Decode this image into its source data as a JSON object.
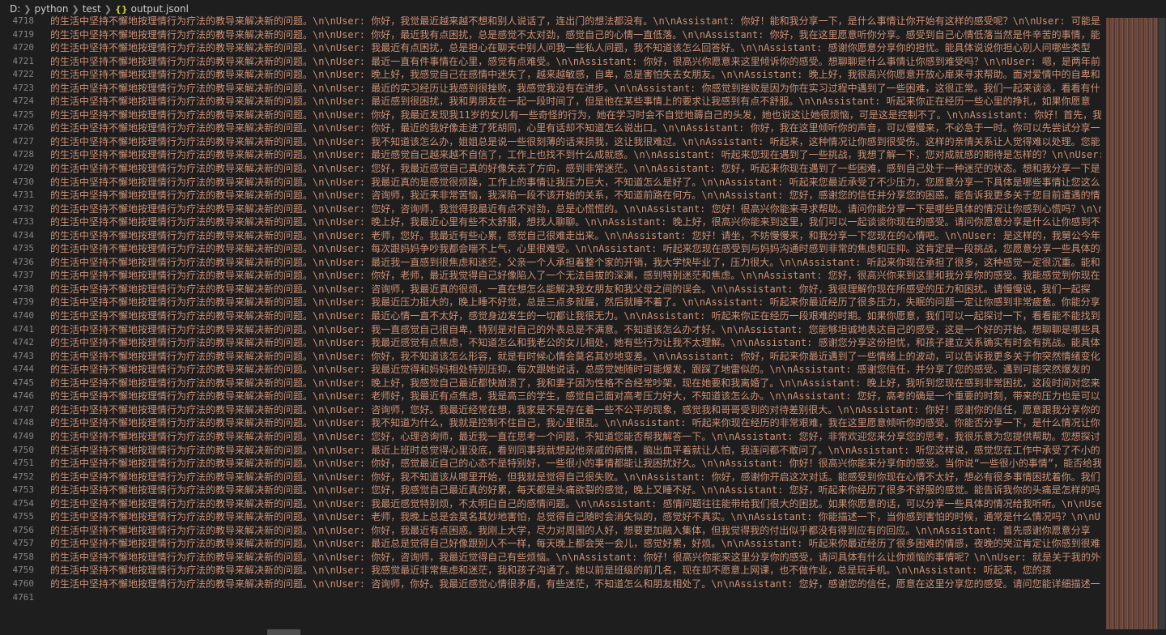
{
  "breadcrumb": {
    "drive": "D:",
    "folder1": "python",
    "folder2": "test",
    "icon": "{}",
    "file": "output.jsonl"
  },
  "editor": {
    "lines": [
      {
        "num": "4718",
        "text": "的生活中坚持不懈地按理情行为疗法的教导来解决新的问题。\\n\\nUser: 你好，我觉最近越来越不想和别人说话了，连出门的想法都没有。\\n\\nAssistant: 你好！能和我分享一下，是什么事情让你开始有这样的感受呢？\\n\\nUser: 可能是从"
      },
      {
        "num": "4719",
        "text": "的生活中坚持不懈地按理情行为疗法的教导来解决新的问题。\\n\\nUser: 你好，最近我有点困扰，总是感觉不太对劲，感觉自己的心情一直低落。\\n\\nAssistant: 你好，我在这里愿意听你分享。感受到自己心情低落当然是件辛苦的事情，能"
      },
      {
        "num": "4720",
        "text": "的生活中坚持不懈地按理情行为疗法的教导来解决新的问题。\\n\\nUser: 我最近有点困扰，总是担心在聊天中别人问我一些私人问题，我不知道该怎么回答好。\\n\\nAssistant: 感谢你愿意分享你的担忧。能具体说说你担心别人问哪些类型"
      },
      {
        "num": "4721",
        "text": "的生活中坚持不懈地按理情行为疗法的教导来解决新的问题。\\n\\nUser: 最近一直有件事情在心里，感觉有点难受。\\n\\nAssistant: 你好，很高兴你愿意来这里倾诉你的感受。想聊聊是什么事情让你感到难受吗？\\n\\nUser: 嗯，是两年前的"
      },
      {
        "num": "4722",
        "text": "的生活中坚持不懈地按理情行为疗法的教导来解决新的问题。\\n\\nUser: 晚上好，我感觉自己在感情中迷失了，越来越敏感，自卑，总是害怕失去女朋友。\\n\\nAssistant: 晚上好，我很高兴你愿意开放心扉来寻求帮助。面对爱情中的自卑和"
      },
      {
        "num": "4723",
        "text": "的生活中坚持不懈地按理情行为疗法的教导来解决新的问题。\\n\\nUser: 最近的实习经历让我感到很挫败，我感觉我没有在进步。\\n\\nAssistant: 你感觉到挫败是因为你在实习过程中遇到了一些困难，这很正常。我们一起来谈谈，看看有什"
      },
      {
        "num": "4724",
        "text": "的生活中坚持不懈地按理情行为疗法的教导来解决新的问题。\\n\\nUser: 最近感到很困扰，我和男朋友在一起一段时间了，但是他在某些事情上的要求让我感到有点不舒服。\\n\\nAssistant: 听起来你正在经历一些心里的挣扎，如果你愿意"
      },
      {
        "num": "4725",
        "text": "的生活中坚持不懈地按理情行为疗法的教导来解决新的问题。\\n\\nUser: 你好，我最近发现我11岁的女儿有一些奇怪的行为，她在学习时会不自觉地薅自己的头发，她也说这让她很烦恼，可是这是控制不了。\\n\\nAssistant: 你好！首先，我"
      },
      {
        "num": "4726",
        "text": "的生活中坚持不懈地按理情行为疗法的教导来解决新的问题。\\n\\nUser: 你好，最近的我好像走进了死胡同，心里有话却不知道怎么说出口。\\n\\nAssistant: 你好，我在这里倾听你的声音，可以慢慢来，不必急于一时。你可以先尝试分享一"
      },
      {
        "num": "4727",
        "text": "的生活中坚持不懈地按理情行为疗法的教导来解决新的问题。\\n\\nUser: 我不知道该怎么办，姐姐总是说一些很刻薄的话来损我，这让我很难过。\\n\\nAssistant: 听起来，这种情况让你感到很受伤。这样的亲情关系让人觉得难以处理。您能"
      },
      {
        "num": "4728",
        "text": "的生活中坚持不懈地按理情行为疗法的教导来解决新的问题。\\n\\nUser: 最近感觉自己越来越不自信了，工作上也找不到什么成就感。\\n\\nAssistant: 听起来您现在遇到了一些挑战，我想了解一下，您对成就感的期待是怎样的？\\n\\nUser: 我"
      },
      {
        "num": "4729",
        "text": "的生活中坚持不懈地按理情行为疗法的教导来解决新的问题。\\n\\nUser: 您好，我最近感觉自己真的好像失去了方向，感到非常迷茫。\\n\\nAssistant: 您好，听起来你现在遇到了一些困难，感到自己处于一种迷茫的状态。想和我分享一下是"
      },
      {
        "num": "4730",
        "text": "的生活中坚持不懈地按理情行为疗法的教导来解决新的问题。\\n\\nUser: 我最近真的是感觉很烦躁，工作上的事情让我压力巨大，不知道怎么是好了。\\n\\nAssistant: 听起来您最近承受了不少压力，您愿意分享一下具体是哪些事情让您这么"
      },
      {
        "num": "4731",
        "text": "的生活中坚持不懈地按理情行为疗法的教导来解决新的问题。\\n\\nUser: 咨询师，我近来非常苦恼，我深陷一段不该开始的关系，不知道前路在何方。\\n\\nAssistant: 您好，感谢您的信任并分享您的困惑。能告诉我更多关于您目前遭遇的情"
      },
      {
        "num": "4732",
        "text": "的生活中坚持不懈地按理情行为疗法的教导来解决新的问题。\\n\\nUser: 您好，咨询师，我觉得我最近有点不对劲，总是心慌慌的。\\n\\nAssistant: 您好！很高兴你能来寻求帮助。请问你能分享一下是哪些具体的情况让你感到心慌吗？\\n\\nU"
      },
      {
        "num": "4733",
        "text": "的生活中坚持不懈地按理情行为疗法的教导来解决新的问题。\\n\\nUser: 晚上好，我最近心里有些不太舒服，想找人聊聊。\\n\\nAssistant: 晚上好，很高兴你能来到这里，我们可以一起谈谈你现在的感受。请问你愿意分享是什么让你感到不"
      },
      {
        "num": "4734",
        "text": "的生活中坚持不懈地按理情行为疗法的教导来解决新的问题。\\n\\nUser: 老师，您好。我最近有些心累，感觉自己很难走出来。\\n\\nAssistant: 您好！请坐，不妨慢慢来，和我分享一下您现在的心情吧。\\n\\nUser: 是这样的，我舅公今年高"
      },
      {
        "num": "4735",
        "text": "的生活中坚持不懈地按理情行为疗法的教导来解决新的问题。\\n\\nUser: 每次跟妈妈争吵我都会喘不上气，心里很难受。\\n\\nAssistant: 听起来您现在感受到与妈妈沟通时感到非常的焦虑和压抑。这肯定是一段挑战，您愿意分享一些具体的事情吗？"
      },
      {
        "num": "4736",
        "text": "的生活中坚持不懈地按理情行为疗法的教导来解决新的问题。\\n\\nUser: 最近我一直感到很焦虑和迷茫，父亲一个人承担着整个家的开销，我大学快毕业了，压力很大。\\n\\nAssistant: 听起来你现在承担了很多，这种感觉一定很沉重。能和"
      },
      {
        "num": "4737",
        "text": "的生活中坚持不懈地按理情行为疗法的教导来解决新的问题。\\n\\nUser: 你好，老师，最近我觉得自己好像陷入了一个无法自拔的深渊，感到特别迷茫和焦虑。\\n\\nAssistant: 您好，很高兴你来到这里和我分享你的感受。我能感觉到你现在"
      },
      {
        "num": "4738",
        "text": "的生活中坚持不懈地按理情行为疗法的教导来解决新的问题。\\n\\nUser: 咨询师，我最近真的很烦，一直在想怎么能解决我女朋友和我父母之间的误会。\\n\\nAssistant: 你好，我很理解你现在所感受的压力和困扰。请慢慢说，我们一起探"
      },
      {
        "num": "4739",
        "text": "的生活中坚持不懈地按理情行为疗法的教导来解决新的问题。\\n\\nUser: 我最近压力挺大的，晚上睡不好觉，总是三点多就醒，然后就睡不着了。\\n\\nAssistant: 听起来你最近经历了很多压力，失眠的问题一定让你感到非常疲惫。你能分享"
      },
      {
        "num": "4740",
        "text": "的生活中坚持不懈地按理情行为疗法的教导来解决新的问题。\\n\\nUser: 最近心情一直不太好，感觉身边发生的一切都让我很无力。\\n\\nAssistant: 听起来你正在经历一段艰难的时期。如果你愿意，我们可以一起探讨一下，看看能不能找到"
      },
      {
        "num": "4741",
        "text": "的生活中坚持不懈地按理情行为疗法的教导来解决新的问题。\\n\\nUser: 我一直感觉自己很自卑，特别是对自己的外表总是不满意。不知道该怎么办才好。\\n\\nAssistant: 您能够坦诚地表达自己的感受，这是一个好的开始。想聊聊是哪些具"
      },
      {
        "num": "4742",
        "text": "的生活中坚持不懈地按理情行为疗法的教导来解决新的问题。\\n\\nUser: 我最近感觉有点焦虑，不知道怎么和我老公的女儿相处，她有些行为让我不太理解。\\n\\nAssistant: 感谢您分享这份担忧，和孩子建立关系确实有时会有挑战。能具体"
      },
      {
        "num": "4743",
        "text": "的生活中坚持不懈地按理情行为疗法的教导来解决新的问题。\\n\\nUser: 你好，我不知道该怎么形容，就是有时候心情会莫名其妙地变差。\\n\\nAssistant: 你好，听起来你最近遇到了一些情绪上的波动，可以告诉我更多关于你突然情绪变化"
      },
      {
        "num": "4744",
        "text": "的生活中坚持不懈地按理情行为疗法的教导来解决新的问题。\\n\\nUser: 我最近觉得和妈妈相处特别压抑，每次跟她说话，总感觉她随时可能爆发，跟踩了地雷似的。\\n\\nAssistant: 感谢您信任，并分享了您的感受。遇到可能突然爆发的"
      },
      {
        "num": "4745",
        "text": "的生活中坚持不懈地按理情行为疗法的教导来解决新的问题。\\n\\nUser: 晚上好，我感觉自己最近都快崩溃了，我和妻子因为性格不合经常吵架，现在她要和我离婚了。\\n\\nAssistant: 晚上好，我听到您现在感到非常困扰，这段时间对您来"
      },
      {
        "num": "4746",
        "text": "的生活中坚持不懈地按理情行为疗法的教导来解决新的问题。\\n\\nUser: 老师好，我最近有点焦虑，我是高三的学生，感觉自己面对高考压力好大，不知道该怎么办。\\n\\nAssistant: 您好，高考的确是一个重要的时刻，带来的压力也是可以"
      },
      {
        "num": "4747",
        "text": "的生活中坚持不懈地按理情行为疗法的教导来解决新的问题。\\n\\nUser: 咨询师，您好。我最近经常在想，我家是不是存在着一些不公平的现象，感觉我和哥哥受到的对待差别很大。\\n\\nAssistant: 你好！感谢你的信任，愿意跟我分享你的"
      },
      {
        "num": "4748",
        "text": "的生活中坚持不懈地按理情行为疗法的教导来解决新的问题。\\n\\nUser: 我不知道为什么，我就是控制不住自己，我心里很乱。\\n\\nAssistant: 听起来你现在经历的非常艰难，我在这里愿意倾听你的感受。你能否分享一下，是什么情况让你"
      },
      {
        "num": "4749",
        "text": "的生活中坚持不懈地按理情行为疗法的教导来解决新的问题。\\n\\nUser: 您好，心理咨询师，最近我一直在思考一个问题，不知道您能否帮我解答一下。\\n\\nAssistant: 您好，非常欢迎您来分享您的思考，我很乐意为您提供帮助。您想探讨"
      },
      {
        "num": "4750",
        "text": "的生活中坚持不懈地按理情行为疗法的教导来解决新的问题。\\n\\nUser: 最近上班时总觉得心里没底，看到同事我就想起他亲戚的病情，脑出血平着就让人怕，我连问都不敢问了。\\n\\nAssistant: 听您这样说，感觉您在工作中承受了不小的"
      },
      {
        "num": "4751",
        "text": "的生活中坚持不懈地按理情行为疗法的教导来解决新的问题。\\n\\nUser: 你好，感觉最近自己的心态不是特别好，一些很小的事情都能让我困扰好久。\\n\\nAssistant: 你好！很高兴你能来分享你的感受。当你说“一些很小的事情”，能否给我"
      },
      {
        "num": "4752",
        "text": "的生活中坚持不懈地按理情行为疗法的教导来解决新的问题。\\n\\nUser: 你好，我不知道该从哪里开始，但我就是觉得自己很失败。\\n\\nAssistant: 你好，感谢你开启这次对话。能感受到你现在心情不太好，想必有很多事情困扰着你。我们"
      },
      {
        "num": "4753",
        "text": "的生活中坚持不懈地按理情行为疗法的教导来解决新的问题。\\n\\nUser: 您好，我感觉自己最近真的好累，每天都是头痛欲裂的感觉，晚上又睡不好。\\n\\nAssistant: 您好，听起来你经历了很多不舒服的感觉。能告诉我你的头痛是怎样的吗"
      },
      {
        "num": "4754",
        "text": "的生活中坚持不懈地按理情行为疗法的教导来解决新的问题。\\n\\nUser: 我最近感觉特别烦，不太明白自己的感情问题。\\n\\nAssistant: 感情问题往往能带给我们很大的困扰。如果你愿意的话，可以分享一些具体的情况给我听听。\\n\\nUser"
      },
      {
        "num": "4755",
        "text": "的生活中坚持不懈地按理情行为疗法的教导来解决新的问题。\\n\\nUser: 老师，我晚上总是会莫名其妙地害怕，总觉得自己随时会消失似的，感觉好不真实。\\n\\nAssistant: 你能描述一下，当你感到害怕的时候，通常是什么情况吗？\\n\\nUs"
      },
      {
        "num": "4756",
        "text": "的生活中坚持不懈地按理情行为疗法的教导来解决新的问题。\\n\\nUser: 你好，我最近有点困惑。我刚上大学，尽力对周围的人好，想要更加融入集体，但我觉得我的付出似乎都没有得到应有的回应。\\n\\nAssistant: 首先感谢你愿意分享"
      },
      {
        "num": "4757",
        "text": "的生活中坚持不懈地按理情行为疗法的教导来解决新的问题。\\n\\nUser: 最近总是觉得自己好像跟别人不一样，每天晚上都会哭一会儿，感觉好累，好烦。\\n\\nAssistant: 听起来你最近经历了很多困难的情感，夜晚的哭泣肯定让你感到很难"
      },
      {
        "num": "4758",
        "text": "的生活中坚持不懈地按理情行为疗法的教导来解决新的问题。\\n\\nUser: 你好，咨询师，我最近觉得自己有些烦恼。\\n\\nAssistant: 你好！很高兴你能来这里分享你的感受，请问具体有什么让你烦恼的事情呢？\\n\\nUser: 就是关于我的外貌"
      },
      {
        "num": "4759",
        "text": "的生活中坚持不懈地按理情行为疗法的教导来解决新的问题。\\n\\nUser: 我感觉最近非常焦虑和迷茫，我和孩子沟通了。她以前是班级的前几名，现在却不愿意上网课，也不做作业，总是玩手机。\\n\\nAssistant: 听起来，您的孩"
      },
      {
        "num": "4760",
        "text": "的生活中坚持不懈地按理情行为疗法的教导来解决新的问题。\\n\\nUser: 咨询师，你好。我最近感觉心情很矛盾，有些迷茫，不知道怎么和朋友相处了。\\n\\nAssistant: 您好，感谢您的信任，愿意在这里分享您的感受。请问您能详细描述一"
      },
      {
        "num": "4761",
        "text": ""
      }
    ]
  }
}
